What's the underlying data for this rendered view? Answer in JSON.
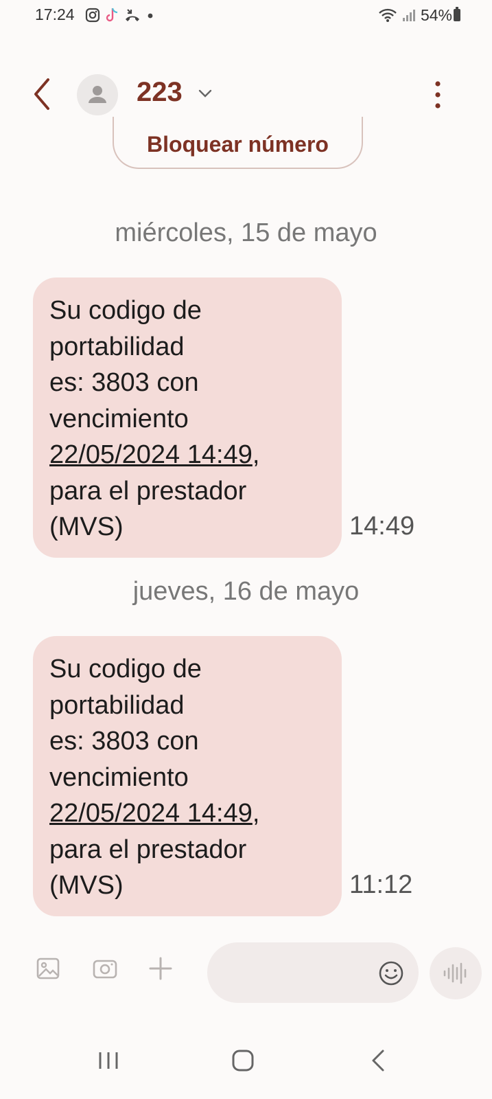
{
  "status_bar": {
    "time": "17:24",
    "battery": "54%",
    "notification_icons": [
      "instagram-icon",
      "tiktok-icon",
      "call-icon",
      "dot-icon"
    ],
    "system_icons": [
      "wifi-icon",
      "signal-icon",
      "battery-icon"
    ]
  },
  "header": {
    "contact_name": "223"
  },
  "block_button": {
    "label": "Bloquear número"
  },
  "conversation": [
    {
      "date": "miércoles, 15 de mayo",
      "message": {
        "lines": [
          "Su codigo de",
          "portabilidad",
          "es: 3803 con",
          "vencimiento"
        ],
        "link_text": "22/05/2024 14:49",
        "after_link": ",",
        "tail_lines": [
          "para el prestador",
          "(MVS)"
        ],
        "time": "14:49"
      }
    },
    {
      "date": "jueves, 16 de mayo",
      "message": {
        "lines": [
          "Su codigo de",
          "portabilidad",
          "es: 3803 con",
          "vencimiento"
        ],
        "link_text": "22/05/2024 14:49",
        "after_link": ",",
        "tail_lines": [
          "para el prestador",
          "(MVS)"
        ],
        "time": "11:12"
      }
    }
  ],
  "composer": {
    "placeholder": "",
    "icons": [
      "gallery-icon",
      "camera-icon",
      "plus-icon",
      "emoji-icon",
      "voice-icon"
    ]
  },
  "colors": {
    "accent": "#7d3224",
    "bubble": "#f4dcd9",
    "background": "#fcfaf9"
  }
}
